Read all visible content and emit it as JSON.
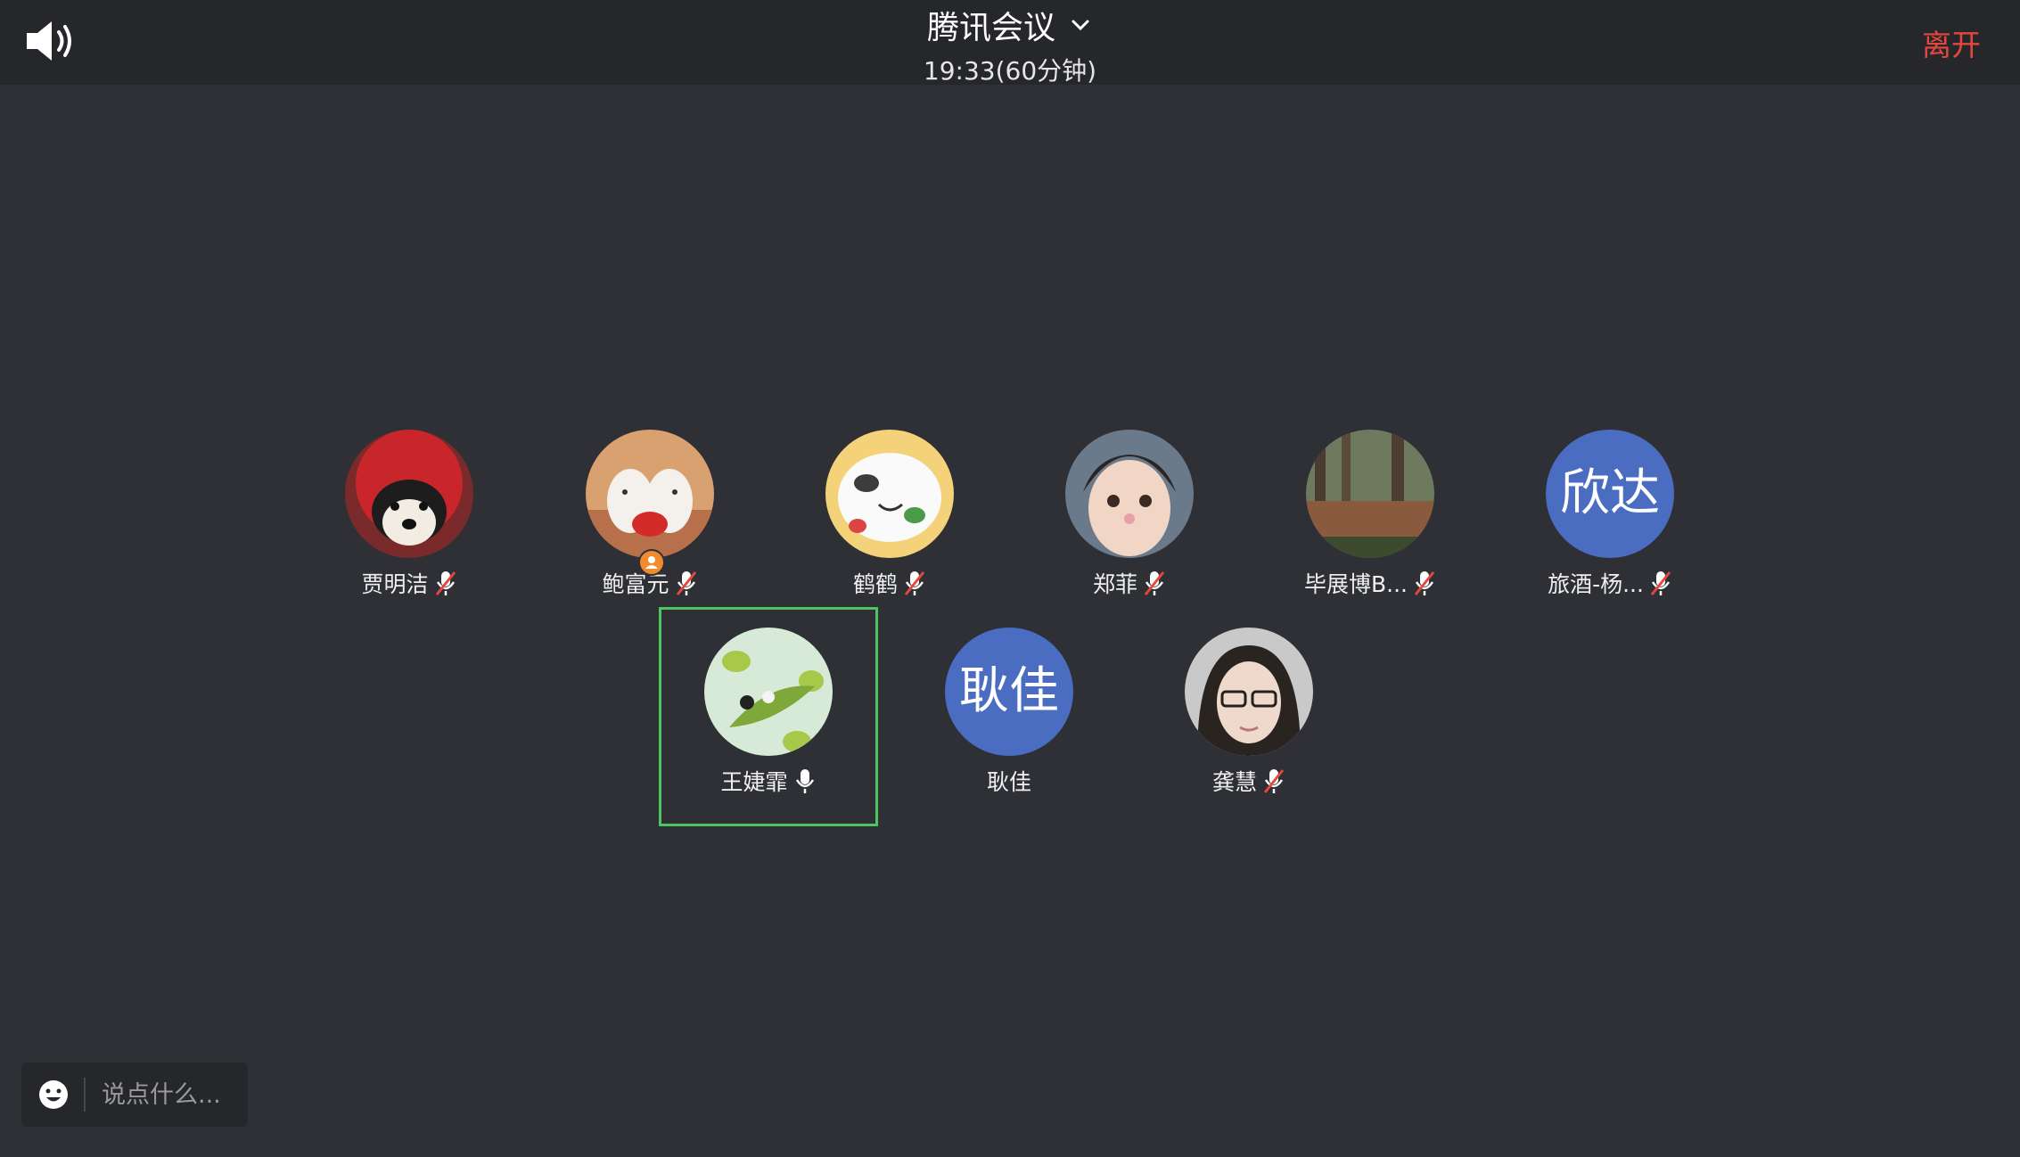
{
  "header": {
    "title": "腾讯会议",
    "time": "19:33(60分钟)",
    "leave_label": "离开"
  },
  "participants": [
    {
      "name": "贾明洁",
      "avatar": "photo",
      "mic": "muted"
    },
    {
      "name": "鲍富元",
      "avatar": "photo",
      "mic": "muted",
      "host": true
    },
    {
      "name": "鹤鹤",
      "avatar": "photo",
      "mic": "muted"
    },
    {
      "name": "郑菲",
      "avatar": "photo",
      "mic": "muted"
    },
    {
      "name": "毕展博B...",
      "avatar": "photo",
      "mic": "muted"
    },
    {
      "name": "旅酒-杨...",
      "avatar_text": "欣达",
      "mic": "muted"
    },
    {
      "name": "王婕霏",
      "avatar": "photo",
      "mic": "on",
      "selected": true
    },
    {
      "name": "耿佳",
      "avatar_text": "耿佳",
      "mic": "none"
    },
    {
      "name": "龚慧",
      "avatar": "photo",
      "mic": "muted"
    }
  ],
  "chat": {
    "placeholder": "说点什么..."
  },
  "colors": {
    "background": "#2e3035",
    "topbar": "#25272b",
    "leave": "#e5473f",
    "selected_border": "#4cc461",
    "text_avatar": "#4a6dc2",
    "host_badge": "#f28a2e"
  }
}
